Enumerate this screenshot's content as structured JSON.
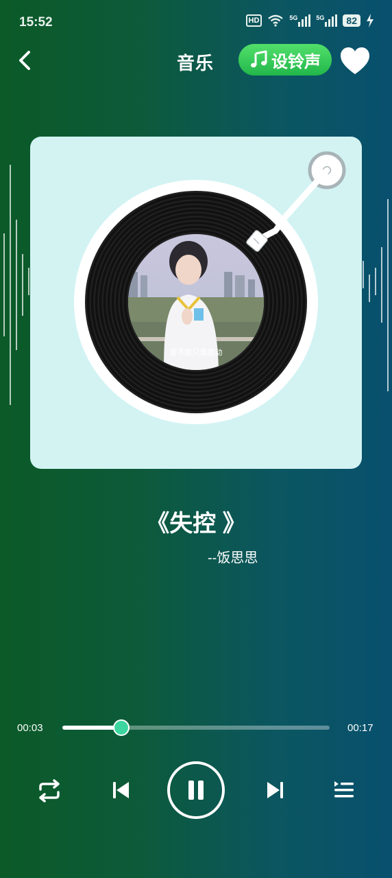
{
  "status_bar": {
    "time": "15:52",
    "hd": "HD",
    "net1": "5G",
    "net2": "5G",
    "battery": "82"
  },
  "header": {
    "title": "音乐",
    "ringtone_label": "设铃声",
    "icons": [
      "back-arrow",
      "music-note",
      "heart"
    ]
  },
  "album": {
    "cover_caption": "爱不能只靠感动"
  },
  "song": {
    "title": "《失控 》",
    "artist": "--饭思思"
  },
  "player": {
    "current_time": "00:03",
    "total_time": "00:17",
    "progress": 0.22,
    "controls": [
      "repeat",
      "previous",
      "pause",
      "next",
      "playlist"
    ]
  },
  "colors": {
    "accent_green": "#3cd69e",
    "ring_button": "#2fc455",
    "card_bg": "#d3f3f3"
  }
}
